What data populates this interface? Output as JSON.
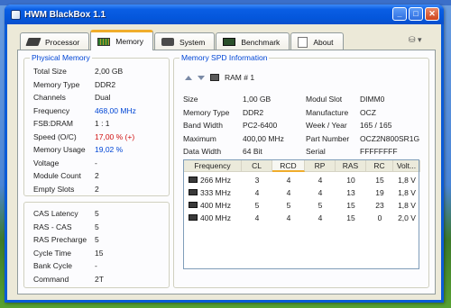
{
  "window": {
    "title": "HWM BlackBox 1.1"
  },
  "tabs": [
    {
      "label": "Processor",
      "icon": "cpu-icon"
    },
    {
      "label": "Memory",
      "icon": "memory-module-icon",
      "active": true
    },
    {
      "label": "System",
      "icon": "system-icon"
    },
    {
      "label": "Benchmark",
      "icon": "benchmark-icon"
    },
    {
      "label": "About",
      "icon": "about-document-icon"
    }
  ],
  "physical_memory": {
    "title": "Physical Memory",
    "rows": [
      {
        "label": "Total Size",
        "value": "2,00 GB"
      },
      {
        "label": "Memory Type",
        "value": "DDR2"
      },
      {
        "label": "Channels",
        "value": "Dual"
      },
      {
        "label": "Frequency",
        "value": "468,00 MHz",
        "color": "#0046d5"
      },
      {
        "label": "FSB:DRAM",
        "value": "1 : 1"
      },
      {
        "label": "Speed (O/C)",
        "value": "17,00 % (+)",
        "color": "#d01010"
      },
      {
        "label": "Memory Usage",
        "value": "19,02 %",
        "color": "#0046d5"
      },
      {
        "label": "Voltage",
        "value": "-"
      },
      {
        "label": "Module Count",
        "value": "2"
      },
      {
        "label": "Empty Slots",
        "value": "2"
      }
    ]
  },
  "timings": {
    "rows": [
      {
        "label": "CAS Latency",
        "value": "5"
      },
      {
        "label": "RAS - CAS",
        "value": "5"
      },
      {
        "label": "RAS Precharge",
        "value": "5"
      },
      {
        "label": "Cycle Time",
        "value": "15"
      },
      {
        "label": "Bank Cycle",
        "value": "-"
      },
      {
        "label": "Command",
        "value": "2T"
      }
    ]
  },
  "spd": {
    "title": "Memory SPD Information",
    "selected_module": "RAM # 1",
    "left": [
      {
        "label": "Size",
        "value": "1,00 GB"
      },
      {
        "label": "Memory Type",
        "value": "DDR2"
      },
      {
        "label": "Band Width",
        "value": "PC2-6400"
      },
      {
        "label": "Maximum",
        "value": "400,00 MHz"
      },
      {
        "label": "Data Width",
        "value": "64 Bit"
      }
    ],
    "right": [
      {
        "label": "Modul Slot",
        "value": "DIMM0"
      },
      {
        "label": "Manufacture",
        "value": "OCZ"
      },
      {
        "label": "Week / Year",
        "value": "165 / 165"
      },
      {
        "label": "Part Number",
        "value": "OCZ2N800SR1G"
      },
      {
        "label": "Serial",
        "value": "FFFFFFFF"
      }
    ],
    "table": {
      "columns": [
        "Frequency",
        "CL",
        "RCD",
        "RP",
        "RAS",
        "RC",
        "Volt..."
      ],
      "sorted_column": "RCD",
      "rows": [
        [
          "266 MHz",
          "3",
          "4",
          "4",
          "10",
          "15",
          "1,8 V"
        ],
        [
          "333 MHz",
          "4",
          "4",
          "4",
          "13",
          "19",
          "1,8 V"
        ],
        [
          "400 MHz",
          "5",
          "5",
          "5",
          "15",
          "23",
          "1,8 V"
        ],
        [
          "400 MHz",
          "4",
          "4",
          "4",
          "15",
          "0",
          "2,0 V"
        ]
      ]
    }
  },
  "colors": {
    "accent": "#0046d5",
    "warning": "#d01010",
    "tab_highlight": "#f0ad2c",
    "titlebar": "#0456db"
  }
}
